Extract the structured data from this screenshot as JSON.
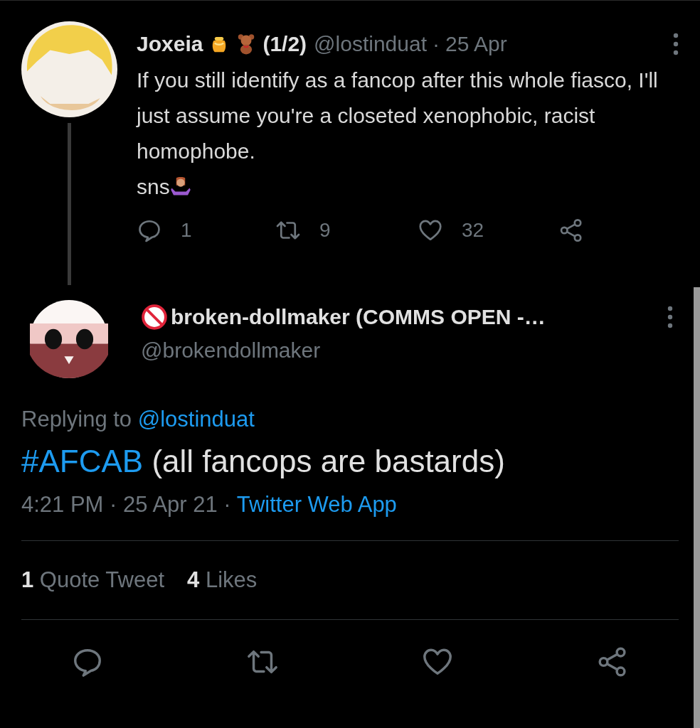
{
  "thread_tweet": {
    "name": "Joxeia",
    "name_suffix": "(1/2)",
    "handle": "@lostinduat",
    "separator": "·",
    "date": "25 Apr",
    "text": "If you still identify as a fancop after this whole fiasco, I'll just assume you're a closeted xenophobic, racist homophobe.\nsns",
    "actions": [
      {
        "kind": "reply",
        "count": "1"
      },
      {
        "kind": "retweet",
        "count": "9"
      },
      {
        "kind": "like",
        "count": "32"
      },
      {
        "kind": "share"
      }
    ]
  },
  "main_tweet": {
    "name": "broken-dollmaker (COMMS OPEN -…",
    "handle": "@brokendollmaker",
    "replying_label": "Replying to",
    "replying_to": "@lostinduat",
    "hashtag": "#AFCAB",
    "text": " (all fancops are bastards)",
    "time": "4:21 PM · 25 Apr 21 · ",
    "source": "Twitter Web App",
    "stats": [
      {
        "count": "1",
        "label": "Quote Tweet"
      },
      {
        "count": "4",
        "label": "Likes"
      }
    ],
    "actions": [
      {
        "kind": "reply"
      },
      {
        "kind": "retweet"
      },
      {
        "kind": "like"
      },
      {
        "kind": "share"
      }
    ]
  }
}
